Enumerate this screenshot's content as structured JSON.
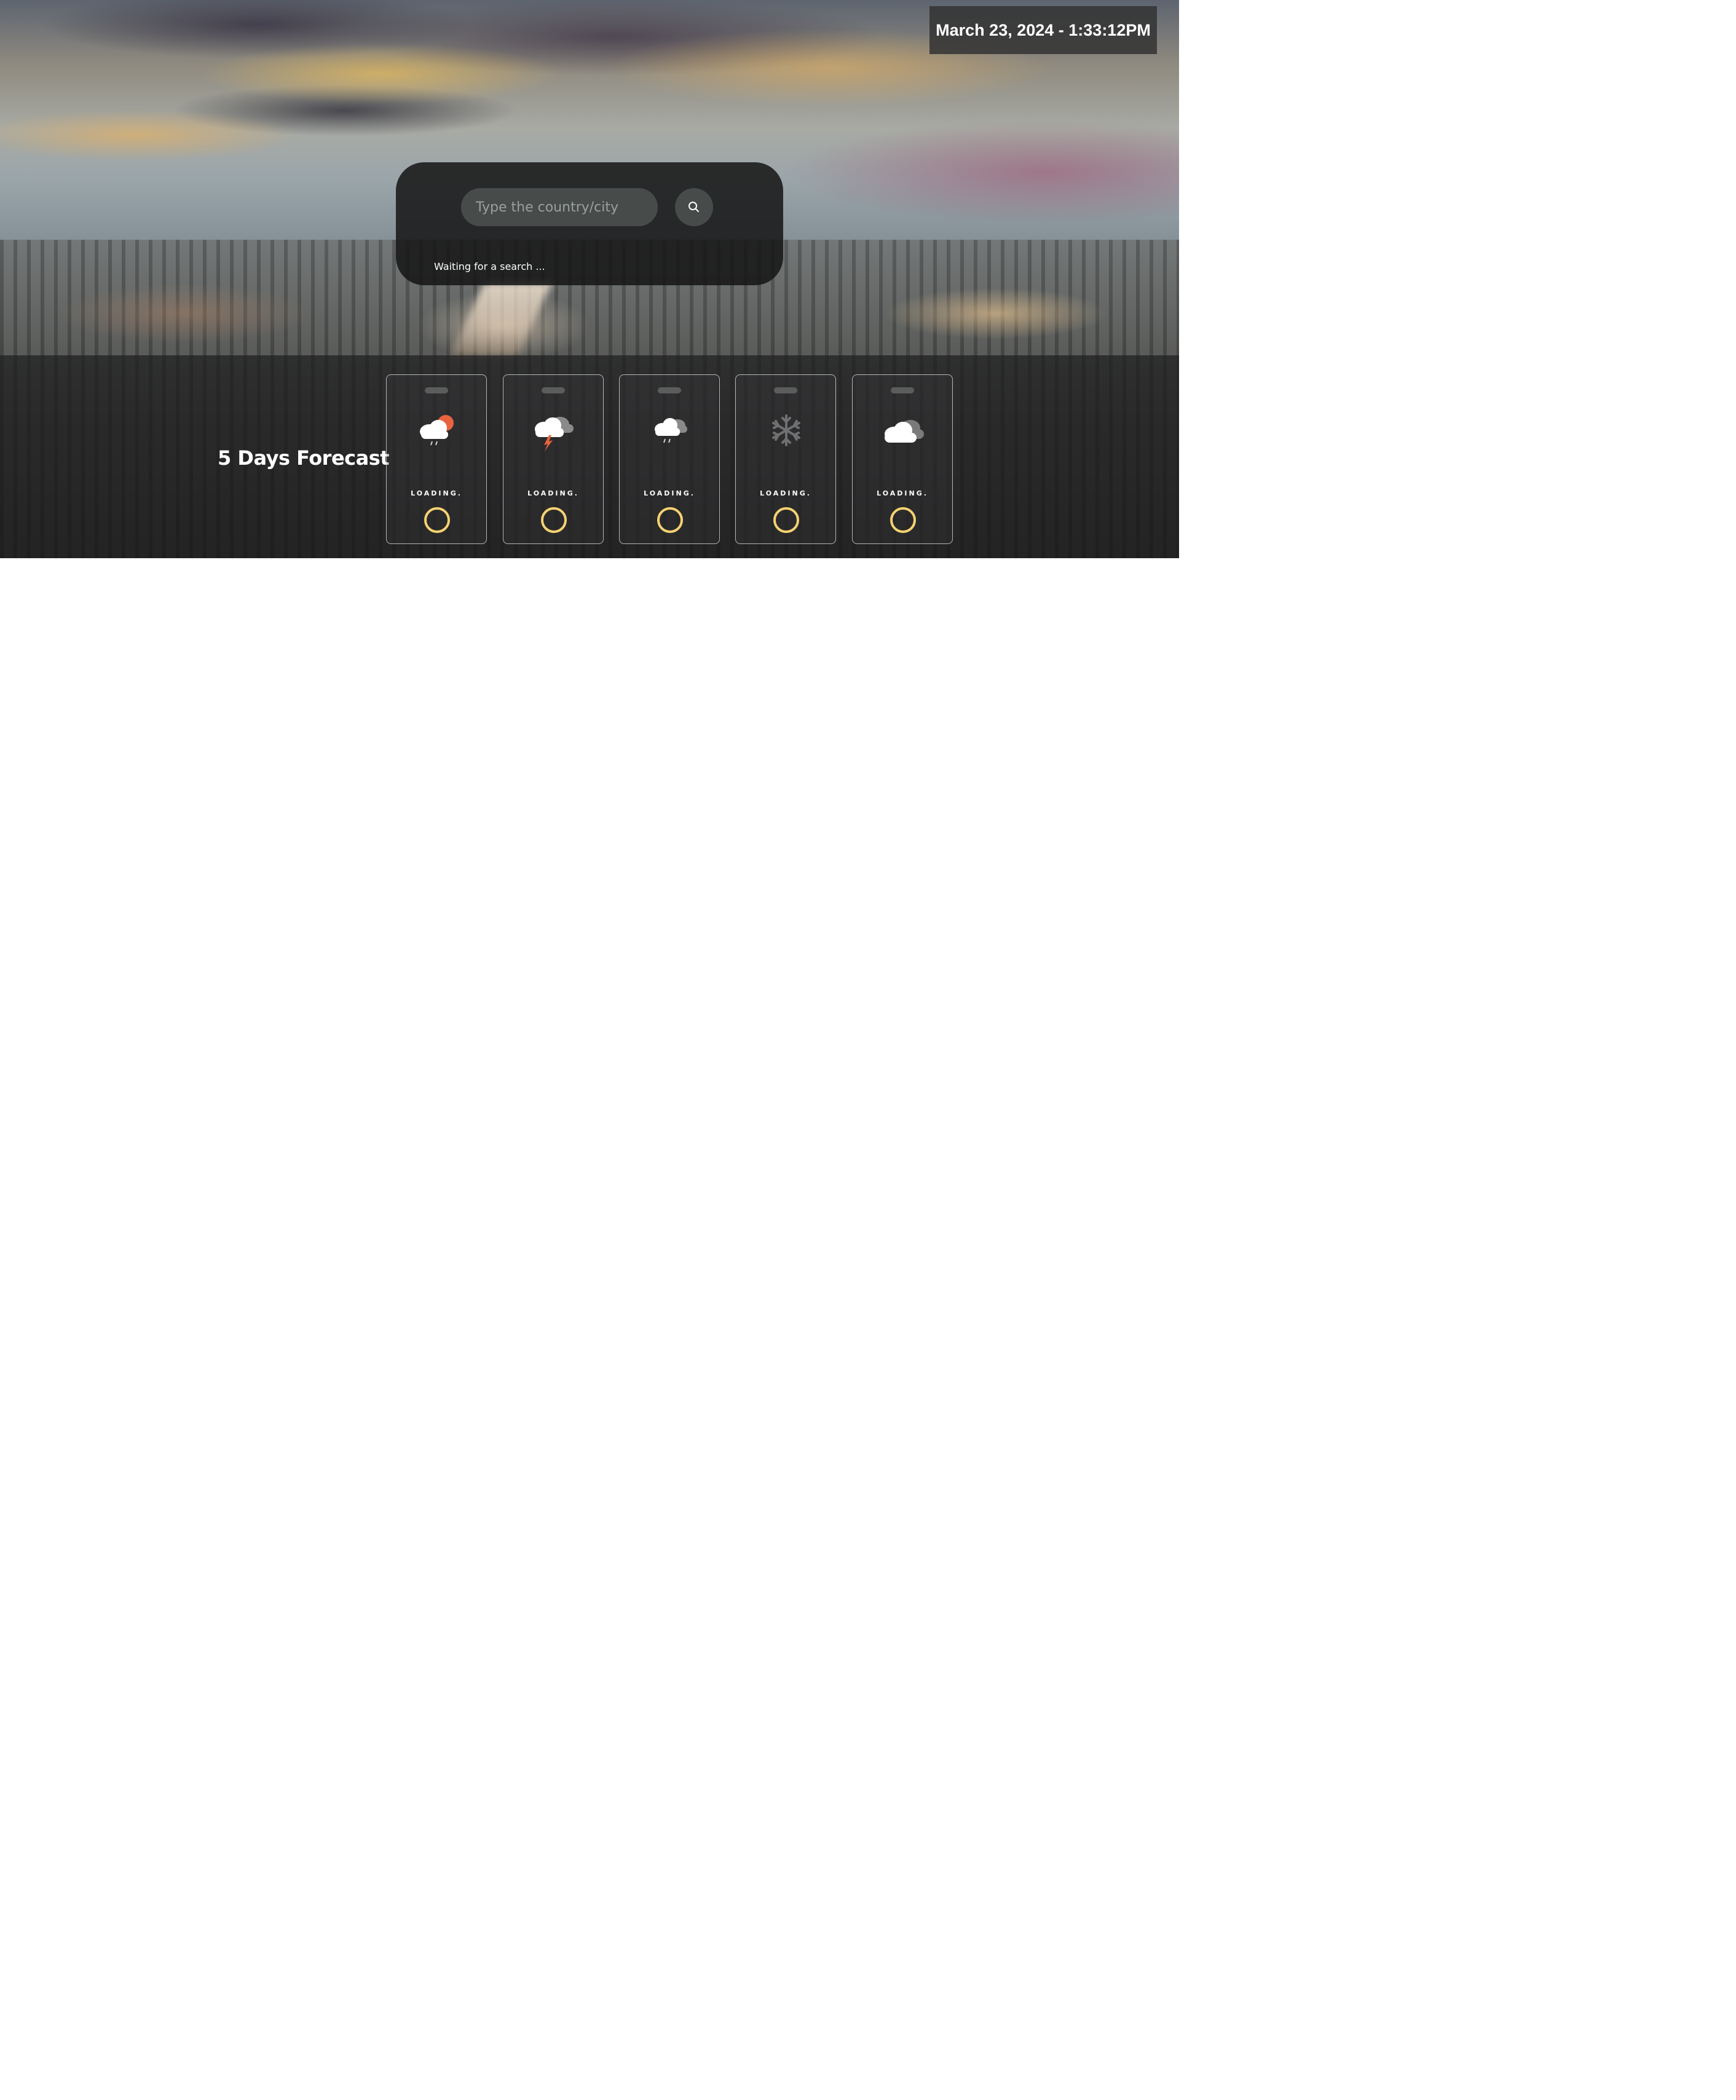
{
  "header": {
    "datetime": "March 23, 2024 - 1:33:12PM"
  },
  "search": {
    "placeholder": "Type the country/city",
    "value": "",
    "button_icon": "search-icon",
    "status": "Waiting for a search ..."
  },
  "forecast": {
    "title": "5 Days Forecast",
    "days": [
      {
        "icon": "sun-cloud-rain-icon",
        "label": "LOADING."
      },
      {
        "icon": "thunderstorm-icon",
        "label": "LOADING."
      },
      {
        "icon": "cloud-rain-icon",
        "label": "LOADING."
      },
      {
        "icon": "snowflake-icon",
        "label": "LOADING."
      },
      {
        "icon": "cloud-icon",
        "label": "LOADING."
      }
    ]
  },
  "colors": {
    "spinner": "#f5d271",
    "sun": "#e8643f",
    "lightning": "#e8643f"
  }
}
